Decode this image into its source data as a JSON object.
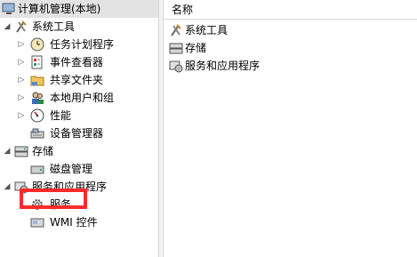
{
  "tree": {
    "root": "计算机管理(本地)",
    "system_tools": "系统工具",
    "task_scheduler": "任务计划程序",
    "event_viewer": "事件查看器",
    "shared_folders": "共享文件夹",
    "local_users": "本地用户和组",
    "performance": "性能",
    "device_manager": "设备管理器",
    "storage": "存储",
    "disk_management": "磁盘管理",
    "services_apps": "服务和应用程序",
    "services": "服务",
    "wmi": "WMI 控件"
  },
  "list": {
    "header": "名称",
    "items": [
      "系统工具",
      "存储",
      "服务和应用程序"
    ]
  },
  "highlight_color": "#ff2b2b"
}
